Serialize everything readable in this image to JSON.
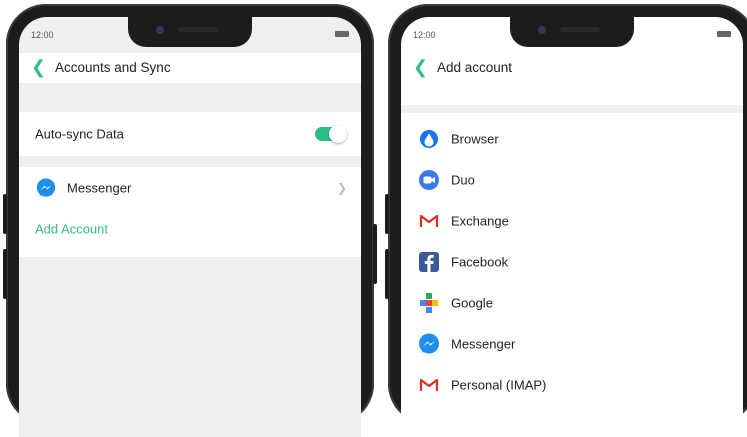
{
  "left_screen": {
    "status_time": "12:00",
    "title": "Accounts and Sync",
    "auto_sync": {
      "label": "Auto-sync Data",
      "enabled": true
    },
    "account": {
      "label": "Messenger"
    },
    "add_account_label": "Add Account"
  },
  "right_screen": {
    "status_time": "12:00",
    "title": "Add account",
    "items": [
      {
        "label": "Browser",
        "icon": "browser-icon"
      },
      {
        "label": "Duo",
        "icon": "duo-icon"
      },
      {
        "label": "Exchange",
        "icon": "gmail-icon"
      },
      {
        "label": "Facebook",
        "icon": "facebook-icon"
      },
      {
        "label": "Google",
        "icon": "google-icon"
      },
      {
        "label": "Messenger",
        "icon": "messenger-icon"
      },
      {
        "label": "Personal (IMAP)",
        "icon": "gmail-icon"
      }
    ]
  },
  "colors": {
    "accent": "#2fbf84",
    "messenger": "#1f8ef1",
    "facebook": "#3b5998",
    "gmail": "#d93025"
  }
}
